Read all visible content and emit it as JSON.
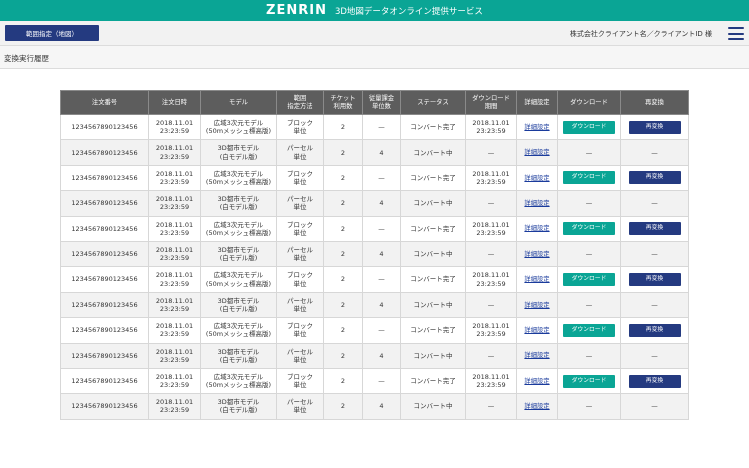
{
  "header": {
    "brand": "ZENRIN",
    "service_name": "3D地図データオンライン提供サービス"
  },
  "subheader": {
    "range_button": "範囲指定（地図）",
    "client_label": "株式会社クライアント名／クライアントID 様",
    "menu_icon": "hamburger-menu-icon"
  },
  "page": {
    "title": "変換実行履歴"
  },
  "table": {
    "columns": [
      "注文番号",
      "注文日時",
      "モデル",
      "範囲\n指定方法",
      "チケット\n利用数",
      "従量課金\n単位数",
      "ステータス",
      "ダウンロード\n期間",
      "詳細設定",
      "ダウンロード",
      "再変換"
    ],
    "rows": [
      {
        "order_no": "1234567890123456",
        "date": "2018.11.01\n23:23:59",
        "model": "広域3次元モデル\n(50mメッシュ標高版)",
        "method": "ブロック\n単位",
        "tickets": "2",
        "units": "—",
        "status": "コンバート完了",
        "period": "2018.11.01\n23:23:59",
        "detail": "詳細設定",
        "download": "ダウンロード",
        "reconvert": "再変換"
      },
      {
        "order_no": "1234567890123456",
        "date": "2018.11.01\n23:23:59",
        "model": "3D都市モデル\n(白モデル版)",
        "method": "パーセル\n単位",
        "tickets": "2",
        "units": "4",
        "status": "コンバート中",
        "period": "—",
        "detail": "詳細設定",
        "download": "—",
        "reconvert": "—"
      },
      {
        "order_no": "1234567890123456",
        "date": "2018.11.01\n23:23:59",
        "model": "広域3次元モデル\n(50mメッシュ標高版)",
        "method": "ブロック\n単位",
        "tickets": "2",
        "units": "—",
        "status": "コンバート完了",
        "period": "2018.11.01\n23:23:59",
        "detail": "詳細設定",
        "download": "ダウンロード",
        "reconvert": "再変換"
      },
      {
        "order_no": "1234567890123456",
        "date": "2018.11.01\n23:23:59",
        "model": "3D都市モデル\n(白モデル版)",
        "method": "パーセル\n単位",
        "tickets": "2",
        "units": "4",
        "status": "コンバート中",
        "period": "—",
        "detail": "詳細設定",
        "download": "—",
        "reconvert": "—"
      },
      {
        "order_no": "1234567890123456",
        "date": "2018.11.01\n23:23:59",
        "model": "広域3次元モデル\n(50mメッシュ標高版)",
        "method": "ブロック\n単位",
        "tickets": "2",
        "units": "—",
        "status": "コンバート完了",
        "period": "2018.11.01\n23:23:59",
        "detail": "詳細設定",
        "download": "ダウンロード",
        "reconvert": "再変換"
      },
      {
        "order_no": "1234567890123456",
        "date": "2018.11.01\n23:23:59",
        "model": "3D都市モデル\n(白モデル版)",
        "method": "パーセル\n単位",
        "tickets": "2",
        "units": "4",
        "status": "コンバート中",
        "period": "—",
        "detail": "詳細設定",
        "download": "—",
        "reconvert": "—"
      },
      {
        "order_no": "1234567890123456",
        "date": "2018.11.01\n23:23:59",
        "model": "広域3次元モデル\n(50mメッシュ標高版)",
        "method": "ブロック\n単位",
        "tickets": "2",
        "units": "—",
        "status": "コンバート完了",
        "period": "2018.11.01\n23:23:59",
        "detail": "詳細設定",
        "download": "ダウンロード",
        "reconvert": "再変換"
      },
      {
        "order_no": "1234567890123456",
        "date": "2018.11.01\n23:23:59",
        "model": "3D都市モデル\n(白モデル版)",
        "method": "パーセル\n単位",
        "tickets": "2",
        "units": "4",
        "status": "コンバート中",
        "period": "—",
        "detail": "詳細設定",
        "download": "—",
        "reconvert": "—"
      },
      {
        "order_no": "1234567890123456",
        "date": "2018.11.01\n23:23:59",
        "model": "広域3次元モデル\n(50mメッシュ標高版)",
        "method": "ブロック\n単位",
        "tickets": "2",
        "units": "—",
        "status": "コンバート完了",
        "period": "2018.11.01\n23:23:59",
        "detail": "詳細設定",
        "download": "ダウンロード",
        "reconvert": "再変換"
      },
      {
        "order_no": "1234567890123456",
        "date": "2018.11.01\n23:23:59",
        "model": "3D都市モデル\n(白モデル版)",
        "method": "パーセル\n単位",
        "tickets": "2",
        "units": "4",
        "status": "コンバート中",
        "period": "—",
        "detail": "詳細設定",
        "download": "—",
        "reconvert": "—"
      },
      {
        "order_no": "1234567890123456",
        "date": "2018.11.01\n23:23:59",
        "model": "広域3次元モデル\n(50mメッシュ標高版)",
        "method": "ブロック\n単位",
        "tickets": "2",
        "units": "—",
        "status": "コンバート完了",
        "period": "2018.11.01\n23:23:59",
        "detail": "詳細設定",
        "download": "ダウンロード",
        "reconvert": "再変換"
      },
      {
        "order_no": "1234567890123456",
        "date": "2018.11.01\n23:23:59",
        "model": "3D都市モデル\n(白モデル版)",
        "method": "パーセル\n単位",
        "tickets": "2",
        "units": "4",
        "status": "コンバート中",
        "period": "—",
        "detail": "詳細設定",
        "download": "—",
        "reconvert": "—"
      }
    ]
  },
  "colors": {
    "header_teal": "#0aa595",
    "navy": "#243a80",
    "table_header": "#5d5d5d"
  }
}
